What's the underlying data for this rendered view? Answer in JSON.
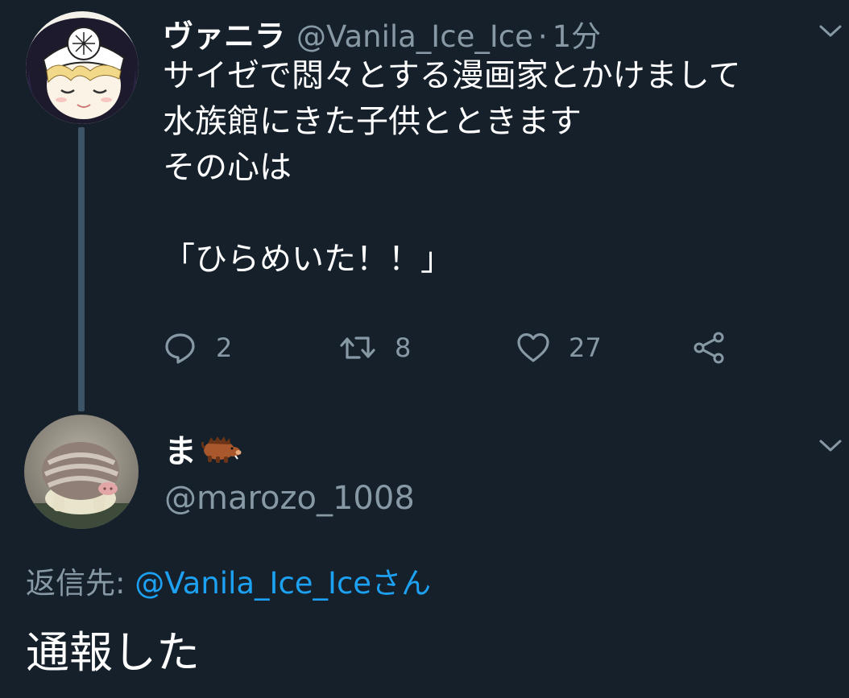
{
  "colors": {
    "background": "#15202b",
    "secondary_text": "#8899a6",
    "link": "#1da1f2",
    "thread_line": "#3d5466"
  },
  "tweet": {
    "display_name": "ヴァニラ",
    "handle": "@Vanila_Ice_Ice",
    "separator": "·",
    "timestamp": "1分",
    "lines": [
      "サイゼで悶々とする漫画家とかけまして",
      "水族館にきた子供とときます",
      "その心は",
      "",
      "「ひらめいた！！」"
    ],
    "actions": {
      "reply_count": "2",
      "retweet_count": "8",
      "like_count": "27"
    },
    "icons": {
      "reply": "reply-icon",
      "retweet": "retweet-icon",
      "like": "heart-icon",
      "share": "share-icon",
      "menu": "chevron-down-icon"
    }
  },
  "reply": {
    "display_name": "ま",
    "name_emoji": "boar-emoji",
    "handle": "@marozo_1008",
    "replying_to_label": "返信先: ",
    "replying_to_mention": "@Vanila_Ice_Iceさん",
    "text": "通報した"
  }
}
